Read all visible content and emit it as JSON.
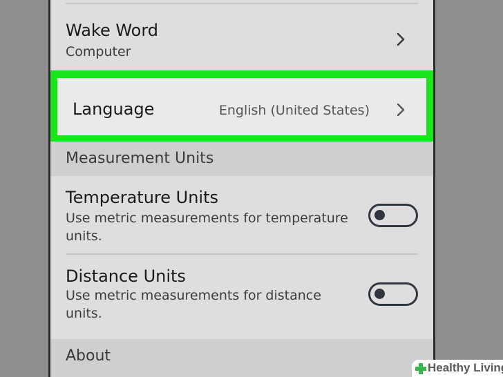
{
  "settings": {
    "wake_word": {
      "title": "Wake Word",
      "value": "Computer"
    },
    "language": {
      "title": "Language",
      "value": "English (United States)"
    },
    "measurement_section": {
      "label": "Measurement Units"
    },
    "temperature": {
      "title": "Temperature Units",
      "description_line1": "Use metric measurements for temperature",
      "description_line2": "units.",
      "enabled": false
    },
    "distance": {
      "title": "Distance Units",
      "description_line1": "Use metric measurements for distance",
      "description_line2": "units.",
      "enabled": false
    },
    "about_section": {
      "label": "About"
    }
  },
  "highlight_color": "#19e619",
  "icons": [
    "chevron-right-icon",
    "toggle-switch",
    "healthy-living-cross-icon"
  ],
  "watermark": {
    "text": "Healthy Living",
    "color": "#39b54a"
  }
}
